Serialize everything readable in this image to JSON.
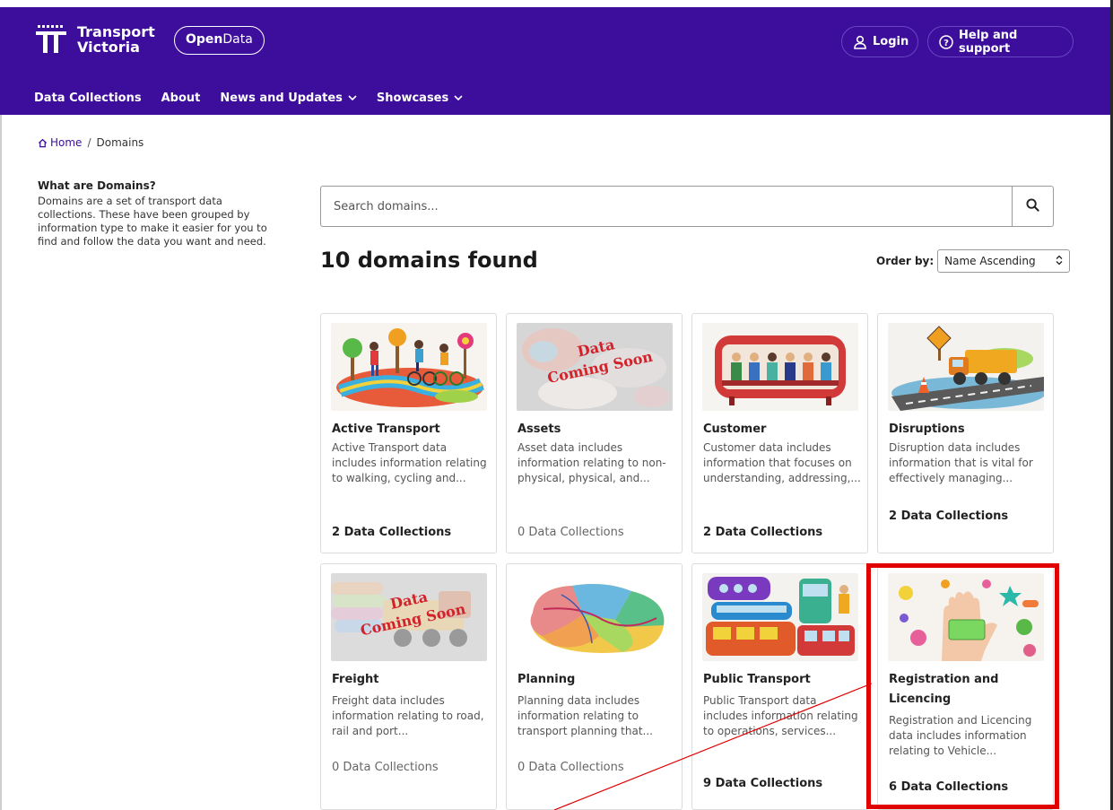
{
  "header": {
    "brand_line1": "Transport",
    "brand_line2": "Victoria",
    "pill_bold": "Open",
    "pill_rest": "Data",
    "login_label": "Login",
    "help_label": "Help and support"
  },
  "nav": {
    "items": [
      {
        "label": "Data Collections",
        "dropdown": false
      },
      {
        "label": "About",
        "dropdown": false
      },
      {
        "label": "News and Updates",
        "dropdown": true
      },
      {
        "label": "Showcases",
        "dropdown": true
      }
    ]
  },
  "breadcrumb": {
    "home": "Home",
    "separator": "/",
    "current": "Domains"
  },
  "sidebar": {
    "heading": "What are Domains?",
    "text": "Domains are a set of transport data collections. These have been grouped by information type to make it easier for you to find and follow the data you want and need."
  },
  "search": {
    "placeholder": "Search domains..."
  },
  "results": {
    "title": "10 domains found",
    "order_label": "Order by:",
    "order_value": "Name Ascending"
  },
  "colors": {
    "brand_purple": "#3d0e9c",
    "highlight_red": "#e00000"
  },
  "cards": [
    {
      "title": "Active Transport",
      "desc": "Active Transport data includes information relating to walking, cycling and...",
      "count": "2 Data Collections",
      "image_overlay": "",
      "icon": "clay-cyclists-image"
    },
    {
      "title": "Assets",
      "desc": "Asset data includes information relating to non-physical, physical, and...",
      "count": "0 Data Collections",
      "image_overlay": "Data Coming Soon",
      "icon": "clay-assets-image"
    },
    {
      "title": "Customer",
      "desc": "Customer data includes information that focuses on understanding, addressing,...",
      "count": "2 Data Collections",
      "image_overlay": "",
      "icon": "clay-bus-passengers-image"
    },
    {
      "title": "Disruptions",
      "desc": "Disruption data includes information that is vital for effectively managing...",
      "count": "2 Data Collections",
      "image_overlay": "",
      "icon": "clay-dump-truck-image"
    },
    {
      "title": "Freight",
      "desc": "Freight data includes information relating to road, rail and port...",
      "count": "0 Data Collections",
      "image_overlay": "Data Coming Soon",
      "icon": "clay-freight-truck-image"
    },
    {
      "title": "Planning",
      "desc": "Planning data includes information relating to transport planning that...",
      "count": "0 Data Collections",
      "image_overlay": "",
      "icon": "clay-map-image"
    },
    {
      "title": "Public Transport",
      "desc": "Public Transport data includes information relating to operations, services...",
      "count": "9 Data Collections",
      "image_overlay": "",
      "icon": "clay-buses-image"
    },
    {
      "title": "Registration and Licencing",
      "desc": "Registration and Licencing data includes information relating to Vehicle...",
      "count": "6 Data Collections",
      "image_overlay": "",
      "icon": "clay-hand-licence-image"
    }
  ]
}
